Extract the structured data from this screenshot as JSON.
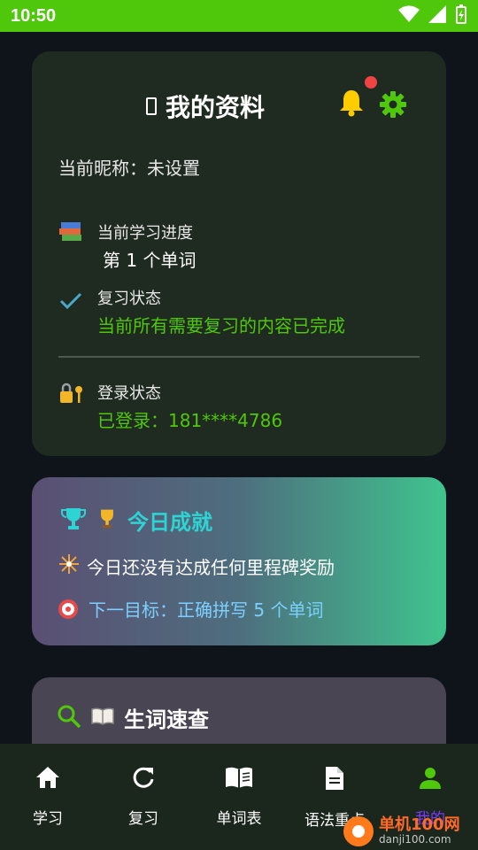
{
  "status_bar": {
    "time": "10:50"
  },
  "profile": {
    "title": "我的资料",
    "nickname_text": "当前昵称：未设置",
    "progress_label": "当前学习进度",
    "progress_value": "第 1 个单词",
    "review_label": "复习状态",
    "review_value": "当前所有需要复习的内容已完成",
    "login_label": "登录状态",
    "login_value": "已登录：181****4786"
  },
  "achievement": {
    "title": "今日成就",
    "line1": "今日还没有达成任何里程碑奖励",
    "line2": "下一目标：正确拼写 5 个单词"
  },
  "lookup": {
    "title": "生词速查"
  },
  "nav": [
    {
      "label": "学习"
    },
    {
      "label": "复习"
    },
    {
      "label": "单词表"
    },
    {
      "label": "语法重点"
    },
    {
      "label": "我的"
    }
  ],
  "watermark": {
    "main": "单机100网",
    "sub": "danji100.com"
  },
  "colors": {
    "status_bar": "#4fc70b",
    "green_value": "#4fc70b",
    "accent_teal": "#2ed3d3",
    "accent_purple": "#7b3cff"
  }
}
